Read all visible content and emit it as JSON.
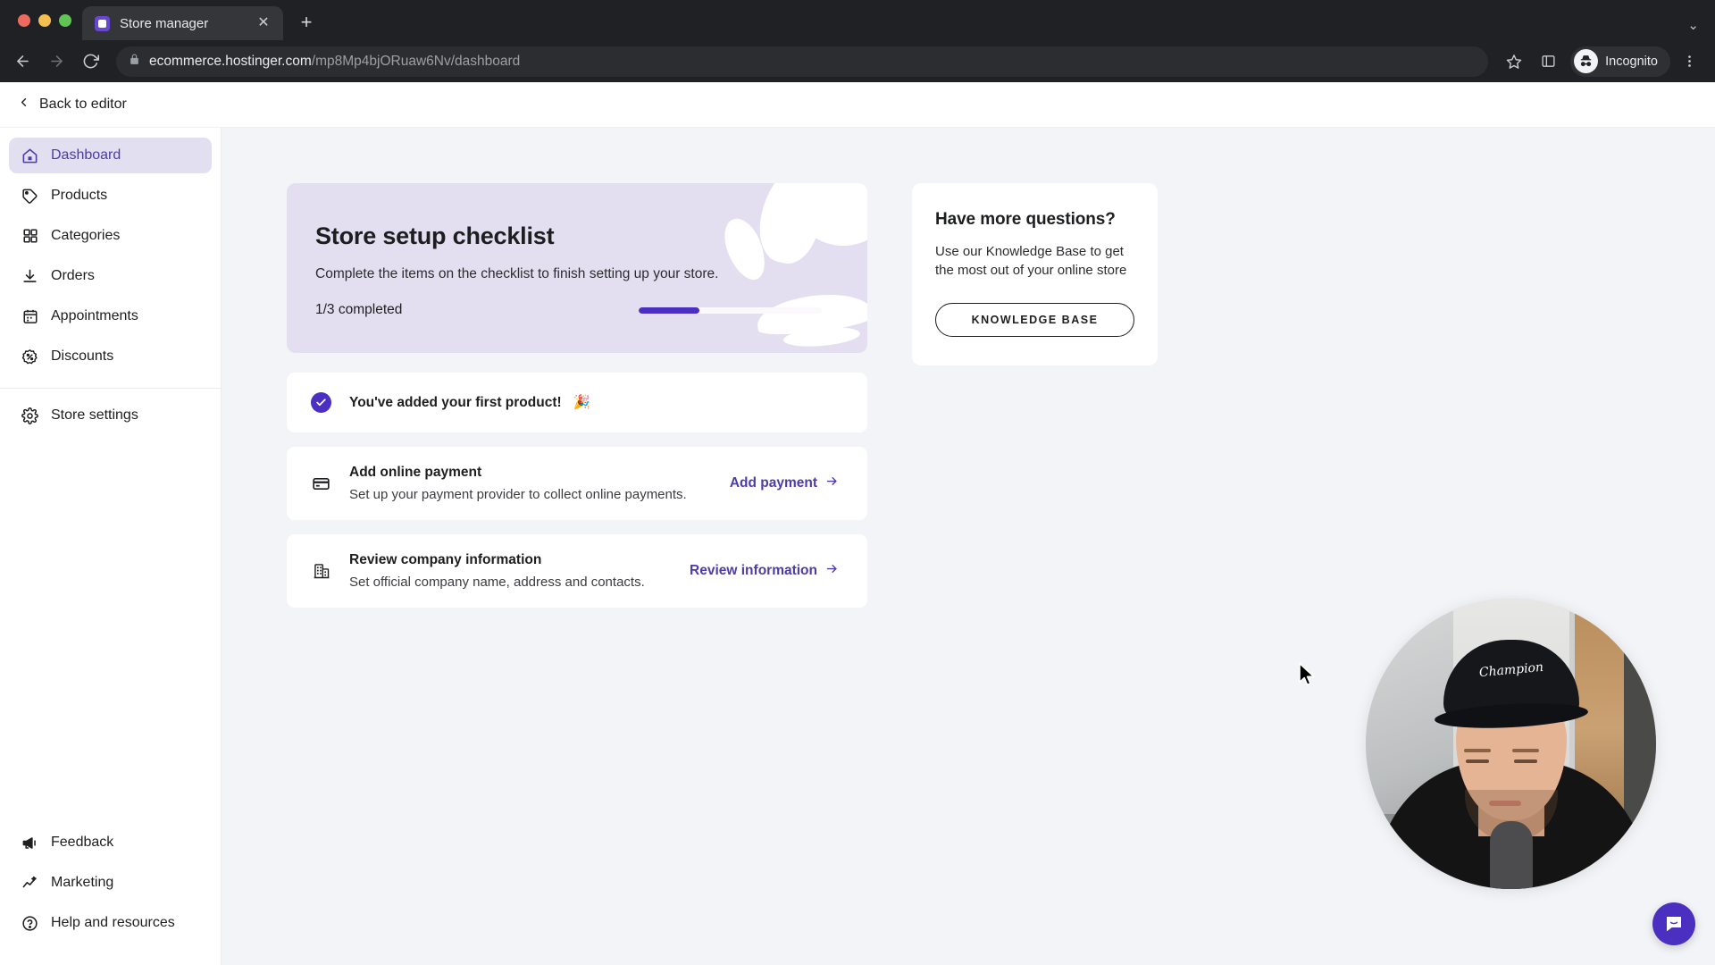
{
  "browser": {
    "tab": {
      "title": "Store manager",
      "favicon": "hostinger-logo-icon",
      "close": "close-icon"
    },
    "new_tab_label": "+",
    "collapse_label": "⌄",
    "nav": {
      "back": "back-arrow-icon",
      "forward": "forward-arrow-icon",
      "reload": "reload-icon"
    },
    "omnibox": {
      "lock": "lock-icon",
      "host": "ecommerce.hostinger.com",
      "path": "/mp8Mp4bjORuaw6Nv/dashboard",
      "full_url": "ecommerce.hostinger.com/mp8Mp4bjORuaw6Nv/dashboard"
    },
    "actions": {
      "bookmark": "star-icon",
      "side_panel": "side-panel-icon",
      "profile_label": "Incognito",
      "menu": "kebab-menu-icon"
    }
  },
  "app": {
    "back_label": "Back to editor",
    "sidebar": {
      "primary": [
        {
          "label": "Dashboard",
          "icon": "home-icon",
          "active": true
        },
        {
          "label": "Products",
          "icon": "tag-icon",
          "active": false
        },
        {
          "label": "Categories",
          "icon": "grid-icon",
          "active": false
        },
        {
          "label": "Orders",
          "icon": "download-icon",
          "active": false
        },
        {
          "label": "Appointments",
          "icon": "calendar-icon",
          "active": false
        },
        {
          "label": "Discounts",
          "icon": "discount-badge-icon",
          "active": false
        }
      ],
      "settings": [
        {
          "label": "Store settings",
          "icon": "gear-icon",
          "active": false
        }
      ],
      "bottom": [
        {
          "label": "Feedback",
          "icon": "megaphone-icon",
          "active": false
        },
        {
          "label": "Marketing",
          "icon": "trending-up-icon",
          "active": false
        },
        {
          "label": "Help and resources",
          "icon": "question-circle-icon",
          "active": false
        }
      ]
    },
    "hero": {
      "title": "Store setup checklist",
      "subtitle": "Complete the items on the checklist to finish setting up your store.",
      "progress_label": "1/3 completed",
      "progress_percent": 33,
      "completed_count": 1,
      "total_count": 3
    },
    "checklist": [
      {
        "title": "You've added your first product!",
        "emoji": "🎉",
        "description": "",
        "action": "",
        "done": true,
        "icon": "check-circle-icon"
      },
      {
        "title": "Add online payment",
        "emoji": "",
        "description": "Set up your payment provider to collect online payments.",
        "action": "Add payment",
        "done": false,
        "icon": "credit-card-icon"
      },
      {
        "title": "Review company information",
        "emoji": "",
        "description": "Set official company name, address and contacts.",
        "action": "Review information",
        "done": false,
        "icon": "building-icon"
      }
    ],
    "questions_card": {
      "title": "Have more questions?",
      "body": "Use our Knowledge Base to get the most out of your online store",
      "button": "KNOWLEDGE BASE"
    },
    "intercom": {
      "icon": "chat-bubble-icon"
    },
    "webcam": {
      "label": "webcam-overlay",
      "cap_logo": "Champion"
    }
  },
  "colors": {
    "accent": "#4b2fc0",
    "accent_text": "#4f3ba8",
    "hero_bg": "#e4dff0",
    "active_nav_bg": "#e2dff1",
    "content_bg": "#f2f4f7",
    "chrome_bg": "#202124"
  }
}
